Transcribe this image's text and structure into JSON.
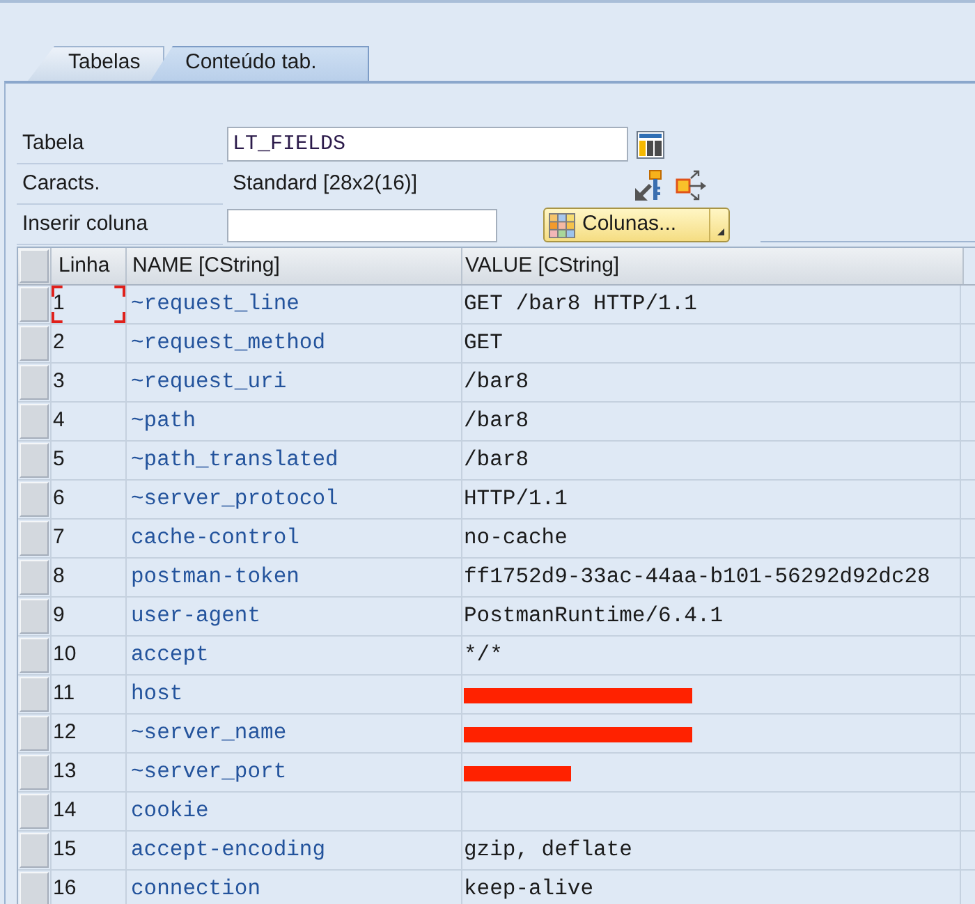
{
  "tabs": [
    {
      "label": "Tabelas",
      "selected": false
    },
    {
      "label": "Conteúdo tab.",
      "selected": true
    }
  ],
  "form": {
    "table_field": {
      "label": "Tabela",
      "value": "LT_FIELDS"
    },
    "characteristics": {
      "label": "Caracts.",
      "value": "Standard [28x2(16)]"
    },
    "insert_column": {
      "label": "Inserir coluna"
    },
    "columns_button": {
      "label": "Colunas..."
    }
  },
  "table": {
    "columns": [
      "Linha",
      "NAME [CString]",
      "VALUE [CString]"
    ],
    "rows": [
      {
        "kind": "text",
        "line": "1",
        "name": "~request_line",
        "value": "GET /bar8 HTTP/1.1",
        "focused": true
      },
      {
        "kind": "text",
        "line": "2",
        "name": "~request_method",
        "value": "GET",
        "focused": false
      },
      {
        "kind": "text",
        "line": "3",
        "name": "~request_uri",
        "value": "/bar8",
        "focused": false
      },
      {
        "kind": "text",
        "line": "4",
        "name": "~path",
        "value": "/bar8",
        "focused": false
      },
      {
        "kind": "text",
        "line": "5",
        "name": "~path_translated",
        "value": "/bar8",
        "focused": false
      },
      {
        "kind": "text",
        "line": "6",
        "name": "~server_protocol",
        "value": "HTTP/1.1",
        "focused": false
      },
      {
        "kind": "text",
        "line": "7",
        "name": "cache-control",
        "value": "no-cache",
        "focused": false
      },
      {
        "kind": "text",
        "line": "8",
        "name": "postman-token",
        "value": "ff1752d9-33ac-44aa-b101-56292d92dc28",
        "focused": false
      },
      {
        "kind": "text",
        "line": "9",
        "name": "user-agent",
        "value": "PostmanRuntime/6.4.1",
        "focused": false
      },
      {
        "kind": "text",
        "line": "10",
        "name": "accept",
        "value": "*/*",
        "focused": false
      },
      {
        "kind": "redacted",
        "line": "11",
        "name": "host",
        "focused": false
      },
      {
        "kind": "redacted",
        "line": "12",
        "name": "~server_name",
        "focused": false
      },
      {
        "kind": "redactedshort",
        "line": "13",
        "name": "~server_port",
        "focused": false
      },
      {
        "kind": "text",
        "line": "14",
        "name": "cookie",
        "focused": false
      },
      {
        "kind": "text",
        "line": "15",
        "name": "accept-encoding",
        "value": "gzip, deflate",
        "focused": false
      },
      {
        "kind": "text",
        "line": "16",
        "name": "connection",
        "value": "keep-alive",
        "focused": false
      }
    ]
  }
}
